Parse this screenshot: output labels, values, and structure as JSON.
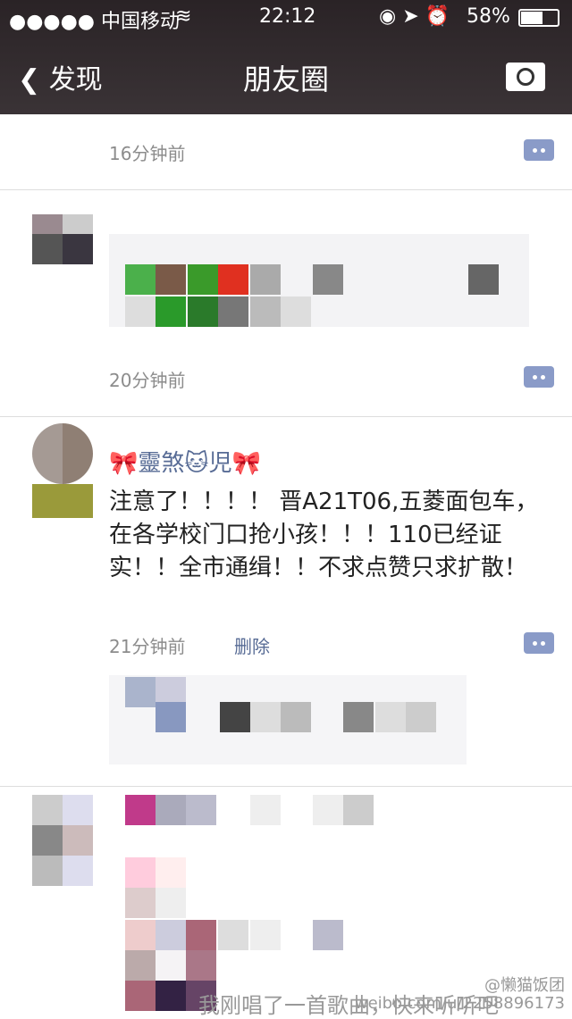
{
  "status_bar": {
    "carrier": "●●●●● 中国移动",
    "time": "22:12",
    "battery": "58%"
  },
  "nav": {
    "back_label": "发现",
    "title": "朋友圈"
  },
  "posts": [
    {
      "time": "16分钟前"
    },
    {
      "time": "20分钟前"
    },
    {
      "name": "🎀靈煞🐱児🎀",
      "text": "注意了！！！！ 晋A21T06,五菱面包车，在各学校门口抢小孩！！！110已经证实！！全市通缉！！不求点赞只求扩散！",
      "time": "21分钟前",
      "delete_label": "删除"
    },
    {
      "text": "我刚唱了一首歌曲，快来听听吧"
    }
  ],
  "watermark": {
    "handle": "@懒猫饭团",
    "url": "weibo.com/u/2258896173"
  }
}
